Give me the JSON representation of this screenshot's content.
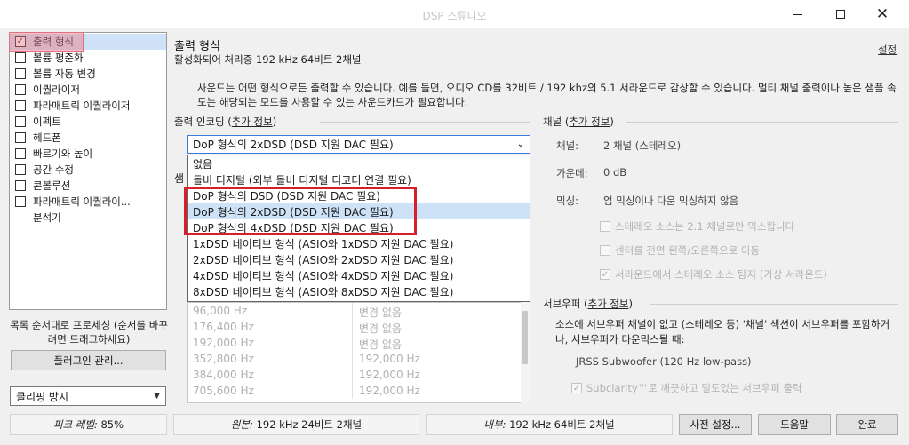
{
  "window": {
    "title": "DSP 스튜디오"
  },
  "plugins": [
    {
      "label": "출력 형식",
      "checked": true
    },
    {
      "label": "볼륨 평준화",
      "checked": false
    },
    {
      "label": "볼륨 자동 변경",
      "checked": false
    },
    {
      "label": "이퀄라이저",
      "checked": false
    },
    {
      "label": "파라매트릭 이퀄라이저",
      "checked": false
    },
    {
      "label": "이펙트",
      "checked": false
    },
    {
      "label": "헤드폰",
      "checked": false
    },
    {
      "label": "빠르기와 높이",
      "checked": false
    },
    {
      "label": "공간 수정",
      "checked": false
    },
    {
      "label": "콘볼루션",
      "checked": false
    },
    {
      "label": "파라매트릭 이퀄라이...",
      "checked": false
    },
    {
      "label": "분석기"
    }
  ],
  "left": {
    "note": "목록 순서대로 프로세싱 (순서를 바꾸려면 드래그하세요)",
    "manage_button": "플러그인 관리...",
    "clip_select": "클리핑 방지"
  },
  "main": {
    "title": "출력 형식",
    "subtitle": "활성화되어 처리중 192 kHz 64비트 2채널",
    "settings_link": "설정",
    "description": "사운드는 어떤 형식으로든 출력할 수 있습니다. 예를 들면, 오디오 CD를 32비트 / 192 khz의 5.1 서라운드로 감상할 수 있습니다.  멀티 채널 출력이나 높은 샘플 속도는 해당되는 모드를 사용할 수 있는 사운드카드가 필요합니다.",
    "encoding_label": "출력 인코딩",
    "encoding_more": "추가 정보",
    "encoding_selected": "DoP 형식의 2xDSD (DSD 지원 DAC 필요)",
    "encoding_options": [
      "없음",
      "돌비 디지털 (외부 돌비 디지털 디코더 연결 필요)",
      "DoP 형식의 DSD (DSD 지원 DAC 필요)",
      "DoP 형식의 2xDSD (DSD 지원 DAC 필요)",
      "DoP 형식의 4xDSD (DSD 지원 DAC 필요)",
      "1xDSD 네이티브 형식 (ASIO와 1xDSD 지원 DAC 필요)",
      "2xDSD 네이티브 형식 (ASIO와 2xDSD 지원 DAC 필요)",
      "4xDSD 네이티브 형식 (ASIO와 4xDSD 지원 DAC 필요)",
      "8xDSD 네이티브 형식 (ASIO와 8xDSD 지원 DAC 필요)"
    ],
    "sample_label_cut": "샘",
    "sample_rows": [
      {
        "in": "96,000 Hz",
        "out": "변경 없음"
      },
      {
        "in": "176,400 Hz",
        "out": "변경 없음"
      },
      {
        "in": "192,000 Hz",
        "out": "변경 없음"
      },
      {
        "in": "352,800 Hz",
        "out": "192,000 Hz"
      },
      {
        "in": "384,000 Hz",
        "out": "192,000 Hz"
      },
      {
        "in": "705,600 Hz",
        "out": "192,000 Hz"
      }
    ]
  },
  "channel": {
    "label": "채널",
    "more": "추가 정보",
    "channels_label": "채널:",
    "channels_value": "2 채널 (스테레오)",
    "gain_label": "가운데:",
    "gain_value": "0 dB",
    "mixing_label": "믹싱:",
    "mixing_value": "업 믹싱이나 다운 믹싱하지 않음",
    "options": [
      {
        "label": "스테레오 소스는 2.1 채널로만 믹스합니다",
        "checked": false
      },
      {
        "label": "센터를 전면 왼쪽/오른쪽으로 이동",
        "checked": false
      },
      {
        "label": "서라운드에서 스테레오 소스 탐지 (가상 서라운드)",
        "checked": true
      }
    ]
  },
  "subwoofer": {
    "label": "서브우퍼",
    "more": "추가 정보",
    "description": "소스에 서브우퍼 채널이 없고 (스테레오 등) '채널' 섹션이 서브우퍼를 포함하거나, 서브우퍼가 다운믹스될 때:",
    "filter": "JRSS Subwoofer (120 Hz low-pass)",
    "subclarity": "Subclarity™로 깨끗하고 밀도있는 서브우퍼 출력",
    "subclarity_checked": true
  },
  "statusbar": {
    "peak_label": "피크 레벨:",
    "peak_value": "85%",
    "source_label": "원본:",
    "source_value": "192 kHz 24비트 2채널",
    "internal_label": "내부:",
    "internal_value": "192 kHz 64비트 2채널"
  },
  "buttons": {
    "presets": "사전 설정...",
    "help": "도움말",
    "done": "완료"
  }
}
